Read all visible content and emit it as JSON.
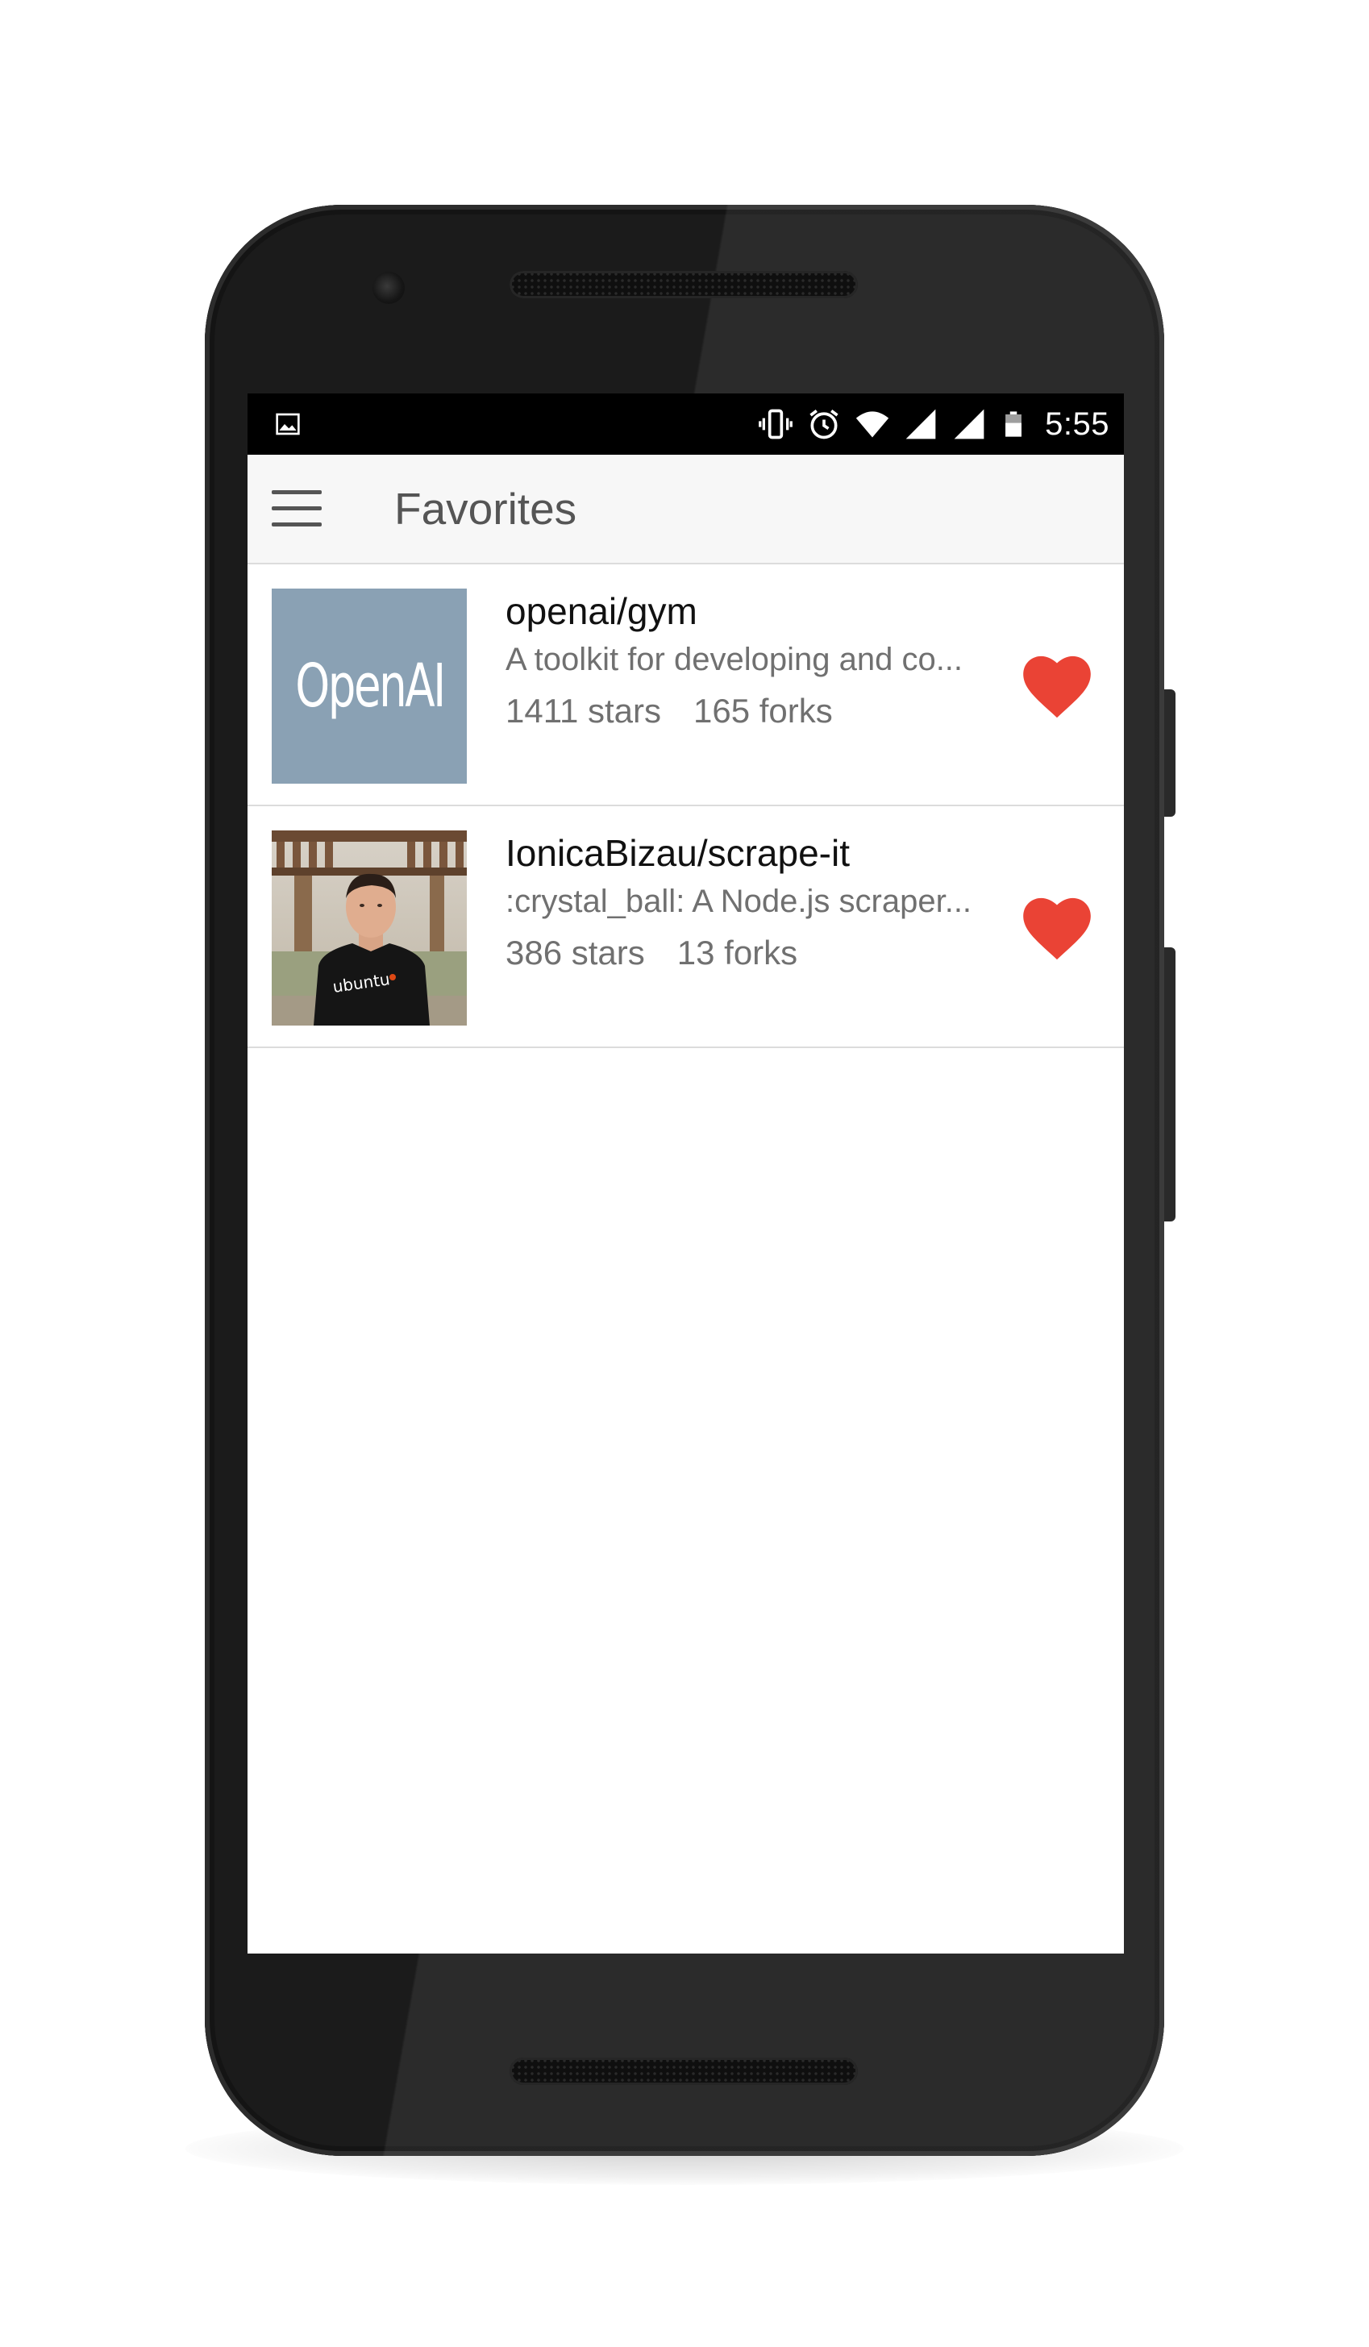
{
  "status_bar": {
    "time": "5:55",
    "left_icon": "image-icon",
    "icons": [
      "vibrate-icon",
      "alarm-icon",
      "wifi-icon",
      "signal-icon",
      "signal-icon",
      "battery-icon"
    ]
  },
  "app_bar": {
    "menu_icon": "hamburger-menu-icon",
    "title": "Favorites"
  },
  "favorites": [
    {
      "thumb_text": "OpenAI",
      "name": "openai/gym",
      "description": "A toolkit for developing and co...",
      "stars": "1411 stars",
      "forks": "165 forks",
      "favorite_icon": "heart-icon"
    },
    {
      "thumb_text": "ubuntu",
      "name": "IonicaBizau/scrape-it",
      "description": ":crystal_ball: A Node.js scraper...",
      "stars": "386 stars",
      "forks": "13 forks",
      "favorite_icon": "heart-icon"
    }
  ],
  "colors": {
    "heart": "#ea4335",
    "openai_tile": "#8aa1b4",
    "app_bar": "#f7f7f7",
    "status_bar": "#000000",
    "phone_body": "#1b1b1b"
  }
}
